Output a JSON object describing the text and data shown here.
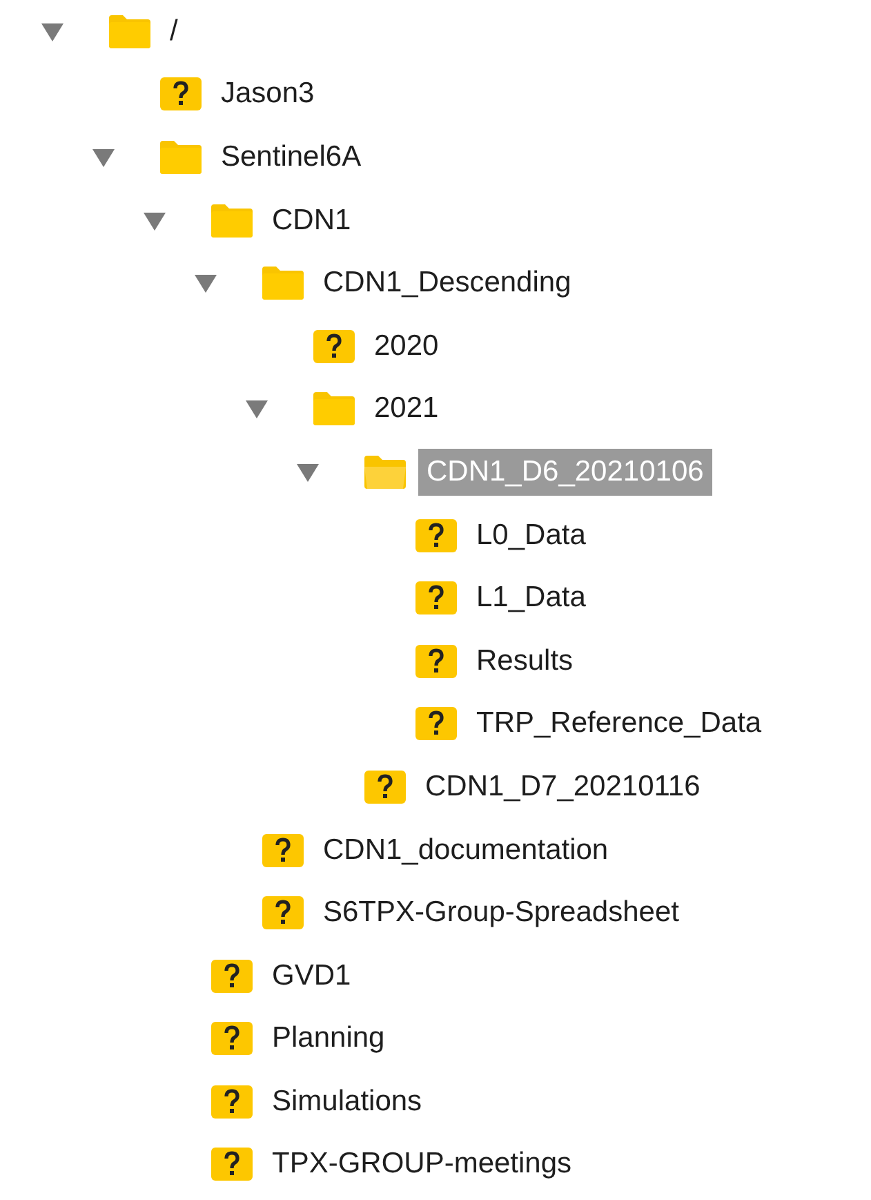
{
  "tree": [
    {
      "kind": "folder",
      "name": "/",
      "expanded": true,
      "selected": false,
      "children": [
        {
          "kind": "unknown",
          "name": "Jason3",
          "selected": false
        },
        {
          "kind": "folder",
          "name": "Sentinel6A",
          "expanded": true,
          "selected": false,
          "children": [
            {
              "kind": "folder",
              "name": "CDN1",
              "expanded": true,
              "selected": false,
              "children": [
                {
                  "kind": "folder",
                  "name": "CDN1_Descending",
                  "expanded": true,
                  "selected": false,
                  "children": [
                    {
                      "kind": "unknown",
                      "name": "2020",
                      "selected": false
                    },
                    {
                      "kind": "folder",
                      "name": "2021",
                      "expanded": true,
                      "selected": false,
                      "children": [
                        {
                          "kind": "folder",
                          "name": "CDN1_D6_20210106",
                          "expanded": true,
                          "selected": true,
                          "children": [
                            {
                              "kind": "unknown",
                              "name": "L0_Data",
                              "selected": false
                            },
                            {
                              "kind": "unknown",
                              "name": "L1_Data",
                              "selected": false
                            },
                            {
                              "kind": "unknown",
                              "name": "Results",
                              "selected": false
                            },
                            {
                              "kind": "unknown",
                              "name": "TRP_Reference_Data",
                              "selected": false
                            }
                          ]
                        },
                        {
                          "kind": "unknown",
                          "name": "CDN1_D7_20210116",
                          "selected": false
                        }
                      ]
                    }
                  ]
                },
                {
                  "kind": "unknown",
                  "name": "CDN1_documentation",
                  "selected": false
                },
                {
                  "kind": "unknown",
                  "name": "S6TPX-Group-Spreadsheet",
                  "selected": false
                }
              ]
            },
            {
              "kind": "unknown",
              "name": "GVD1",
              "selected": false
            },
            {
              "kind": "unknown",
              "name": "Planning",
              "selected": false
            },
            {
              "kind": "unknown",
              "name": "Simulations",
              "selected": false
            },
            {
              "kind": "unknown",
              "name": "TPX-GROUP-meetings",
              "selected": false
            }
          ]
        }
      ]
    }
  ]
}
